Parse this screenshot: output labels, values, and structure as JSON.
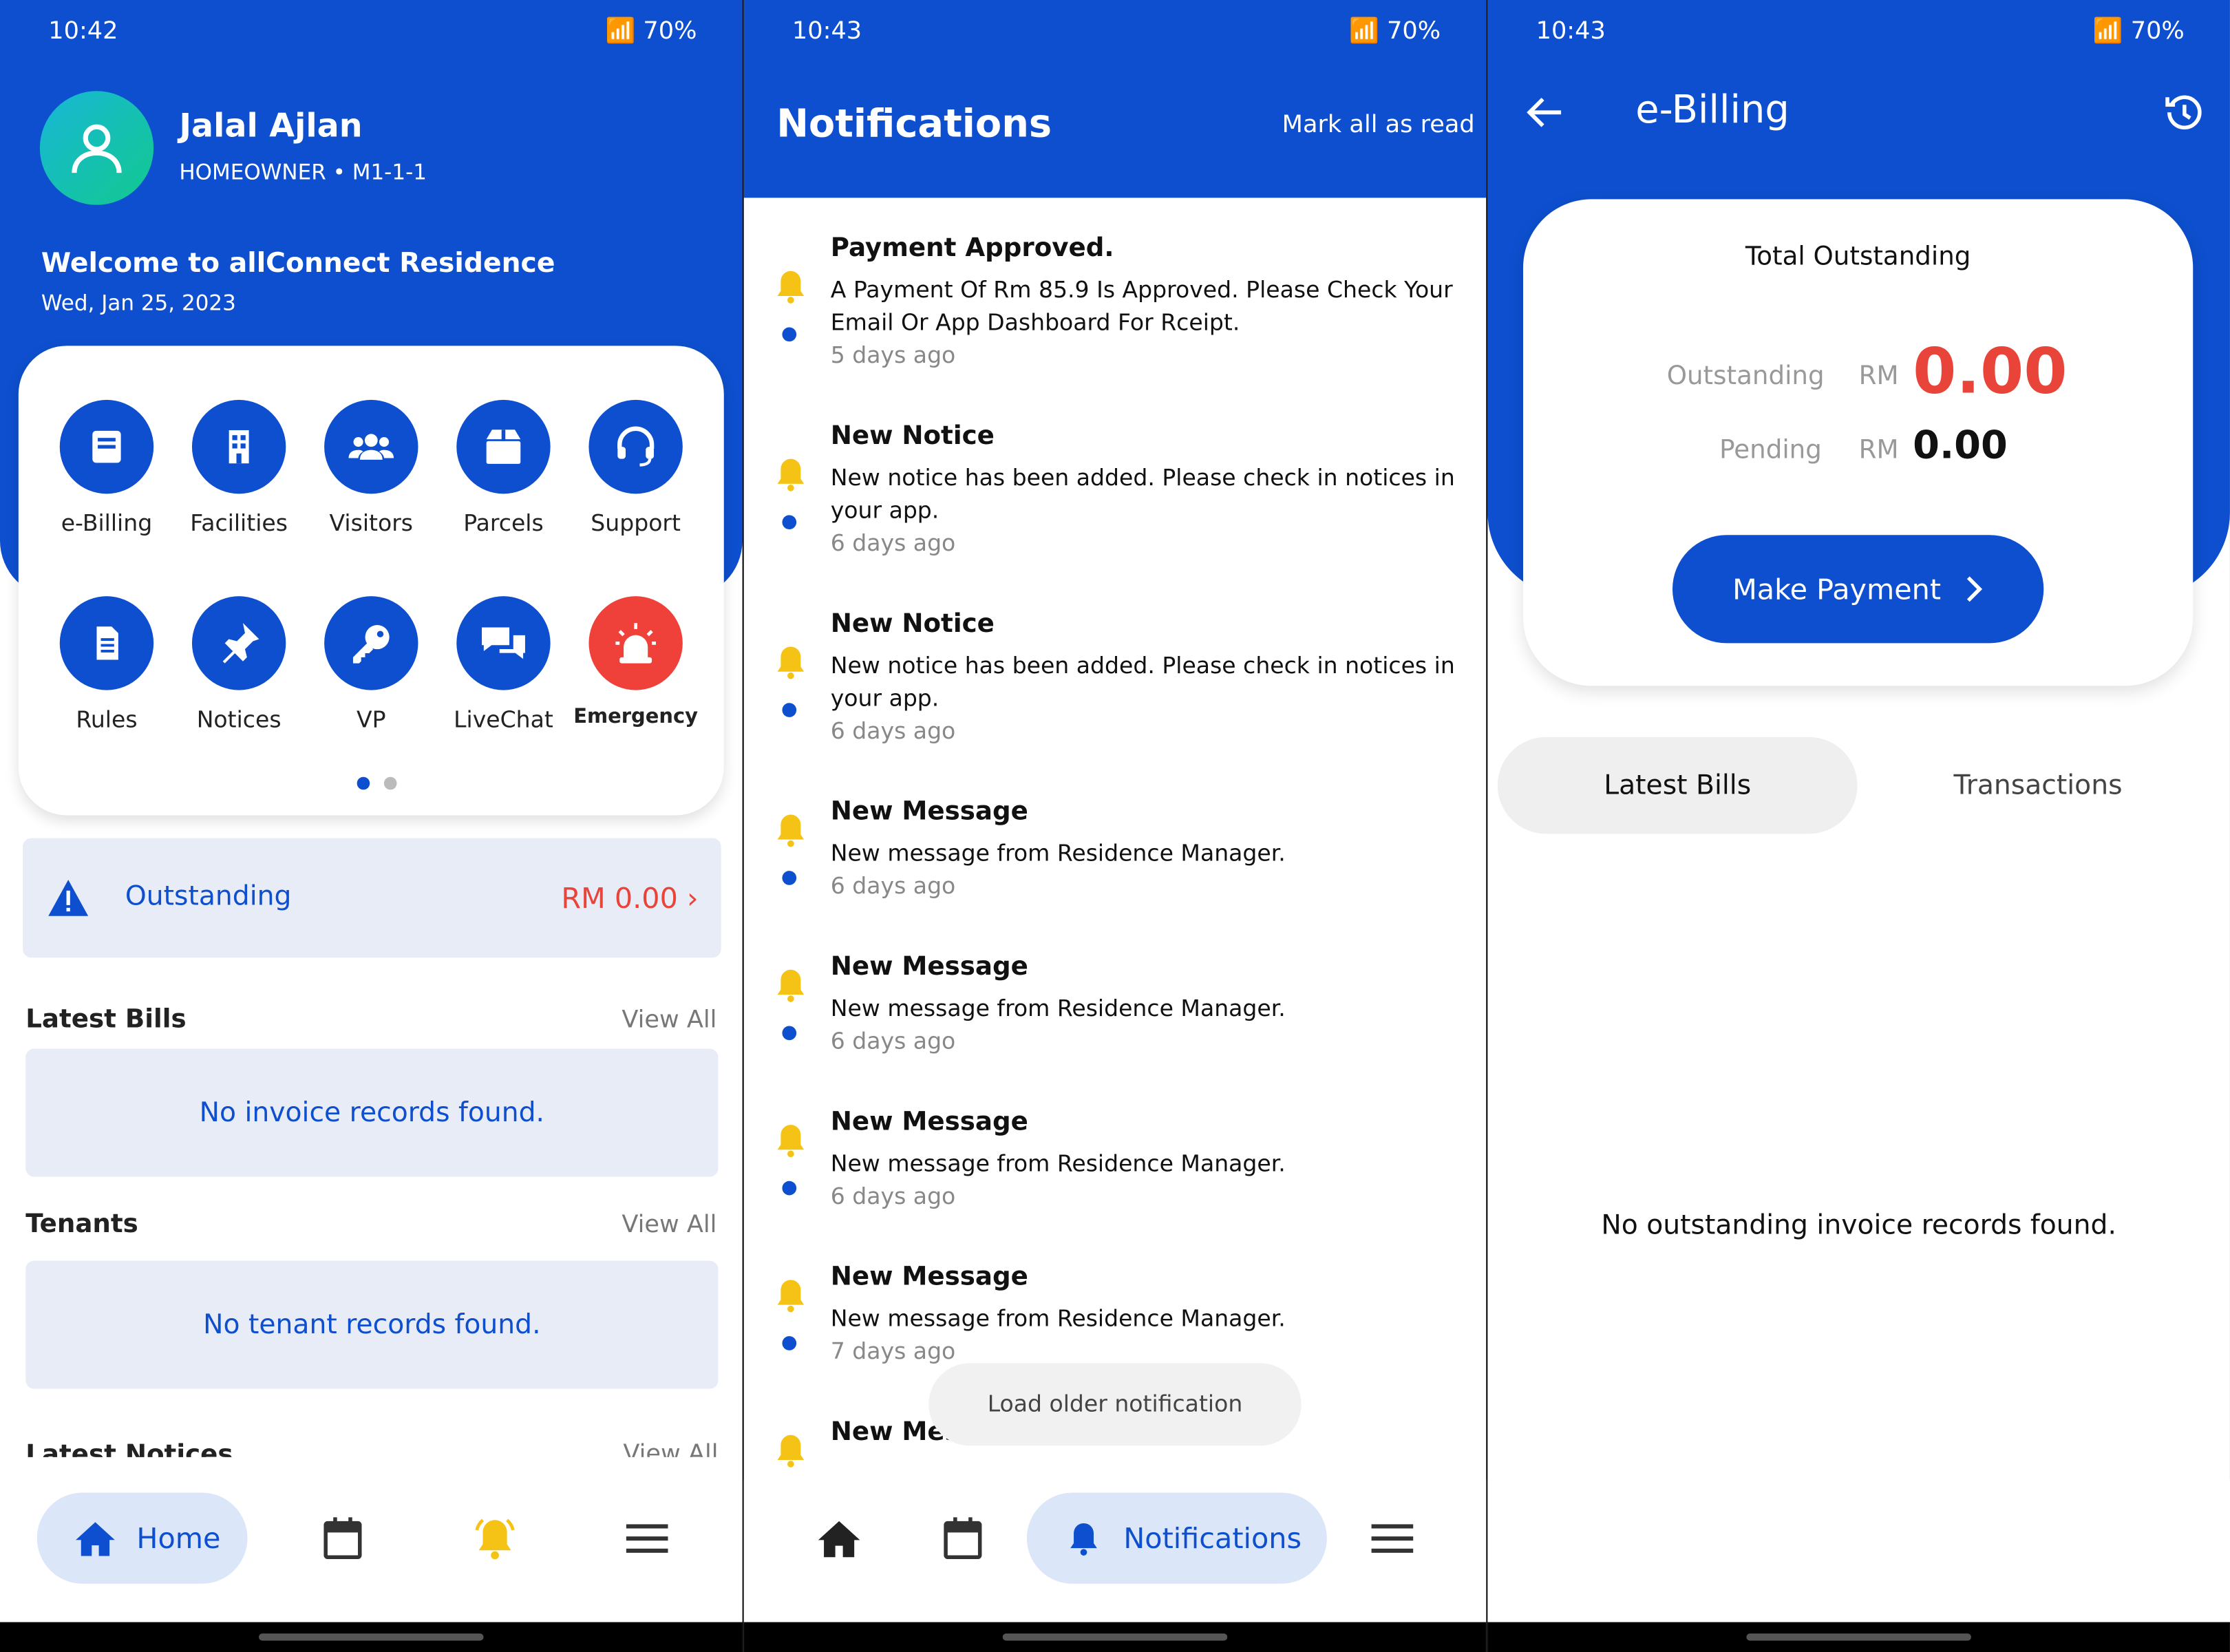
{
  "colors": {
    "primary": "#0d4fce",
    "danger": "#e8443a",
    "bell": "#f5c315",
    "light_bg": "#e7ecf7"
  },
  "screen1": {
    "status": {
      "time": "10:42",
      "battery": "70%"
    },
    "user": {
      "name": "Jalal Ajlan",
      "role": "HOMEOWNER • M1-1-1"
    },
    "welcome_prefix": "Welcome to ",
    "welcome_brand": "allConnect Residence",
    "date": "Wed, Jan 25, 2023",
    "menu": [
      {
        "label": "e-Billing",
        "icon": "book-icon"
      },
      {
        "label": "Facilities",
        "icon": "building-icon"
      },
      {
        "label": "Visitors",
        "icon": "users-icon"
      },
      {
        "label": "Parcels",
        "icon": "box-icon"
      },
      {
        "label": "Support",
        "icon": "headset-icon"
      },
      {
        "label": "Rules",
        "icon": "document-icon"
      },
      {
        "label": "Notices",
        "icon": "pin-icon"
      },
      {
        "label": "VP",
        "icon": "key-icon"
      },
      {
        "label": "LiveChat",
        "icon": "chat-icon"
      },
      {
        "label": "Emergency",
        "icon": "siren-icon"
      }
    ],
    "outstanding": {
      "label": "Outstanding",
      "value": "RM 0.00 ›"
    },
    "latest_bills": {
      "title": "Latest Bills",
      "view_all": "View All",
      "empty": "No invoice records found."
    },
    "tenants": {
      "title": "Tenants",
      "view_all": "View All",
      "empty": "No tenant records found."
    },
    "latest_notices": {
      "title": "Latest Notices",
      "view_all": "View All"
    },
    "nav": {
      "home": "Home"
    }
  },
  "screen2": {
    "status": {
      "time": "10:43",
      "battery": "70%"
    },
    "title": "Notifications",
    "mark_all": "Mark all as read",
    "items": [
      {
        "title": "Payment Approved.",
        "body": "A Payment Of Rm 85.9 Is Approved. Please Check Your Email Or App Dashboard For Rceipt.",
        "time": "5 days ago"
      },
      {
        "title": "New Notice",
        "body": "New notice has been added. Please check in notices in your app.",
        "time": "6 days ago"
      },
      {
        "title": "New Notice",
        "body": "New notice has been added. Please check in notices in your app.",
        "time": "6 days ago"
      },
      {
        "title": "New Message",
        "body": "New message from Residence Manager.",
        "time": "6 days ago"
      },
      {
        "title": "New Message",
        "body": "New message from Residence Manager.",
        "time": "6 days ago"
      },
      {
        "title": "New Message",
        "body": "New message from Residence Manager.",
        "time": "6 days ago"
      },
      {
        "title": "New Message",
        "body": "New message from Residence Manager.",
        "time": "7 days ago"
      },
      {
        "title": "New Mes",
        "body": "",
        "time": ""
      }
    ],
    "load_older": "Load older notification",
    "nav": {
      "notifications": "Notifications"
    }
  },
  "screen3": {
    "status": {
      "time": "10:43",
      "battery": "70%"
    },
    "title": "e-Billing",
    "card_title": "Total Outstanding",
    "outstanding_label": "Outstanding",
    "pending_label": "Pending",
    "currency": "RM",
    "outstanding_value": "0.00",
    "pending_value": "0.00",
    "pay_button": "Make Payment",
    "tabs": {
      "latest": "Latest Bills",
      "transactions": "Transactions"
    },
    "empty": "No outstanding invoice records found."
  }
}
